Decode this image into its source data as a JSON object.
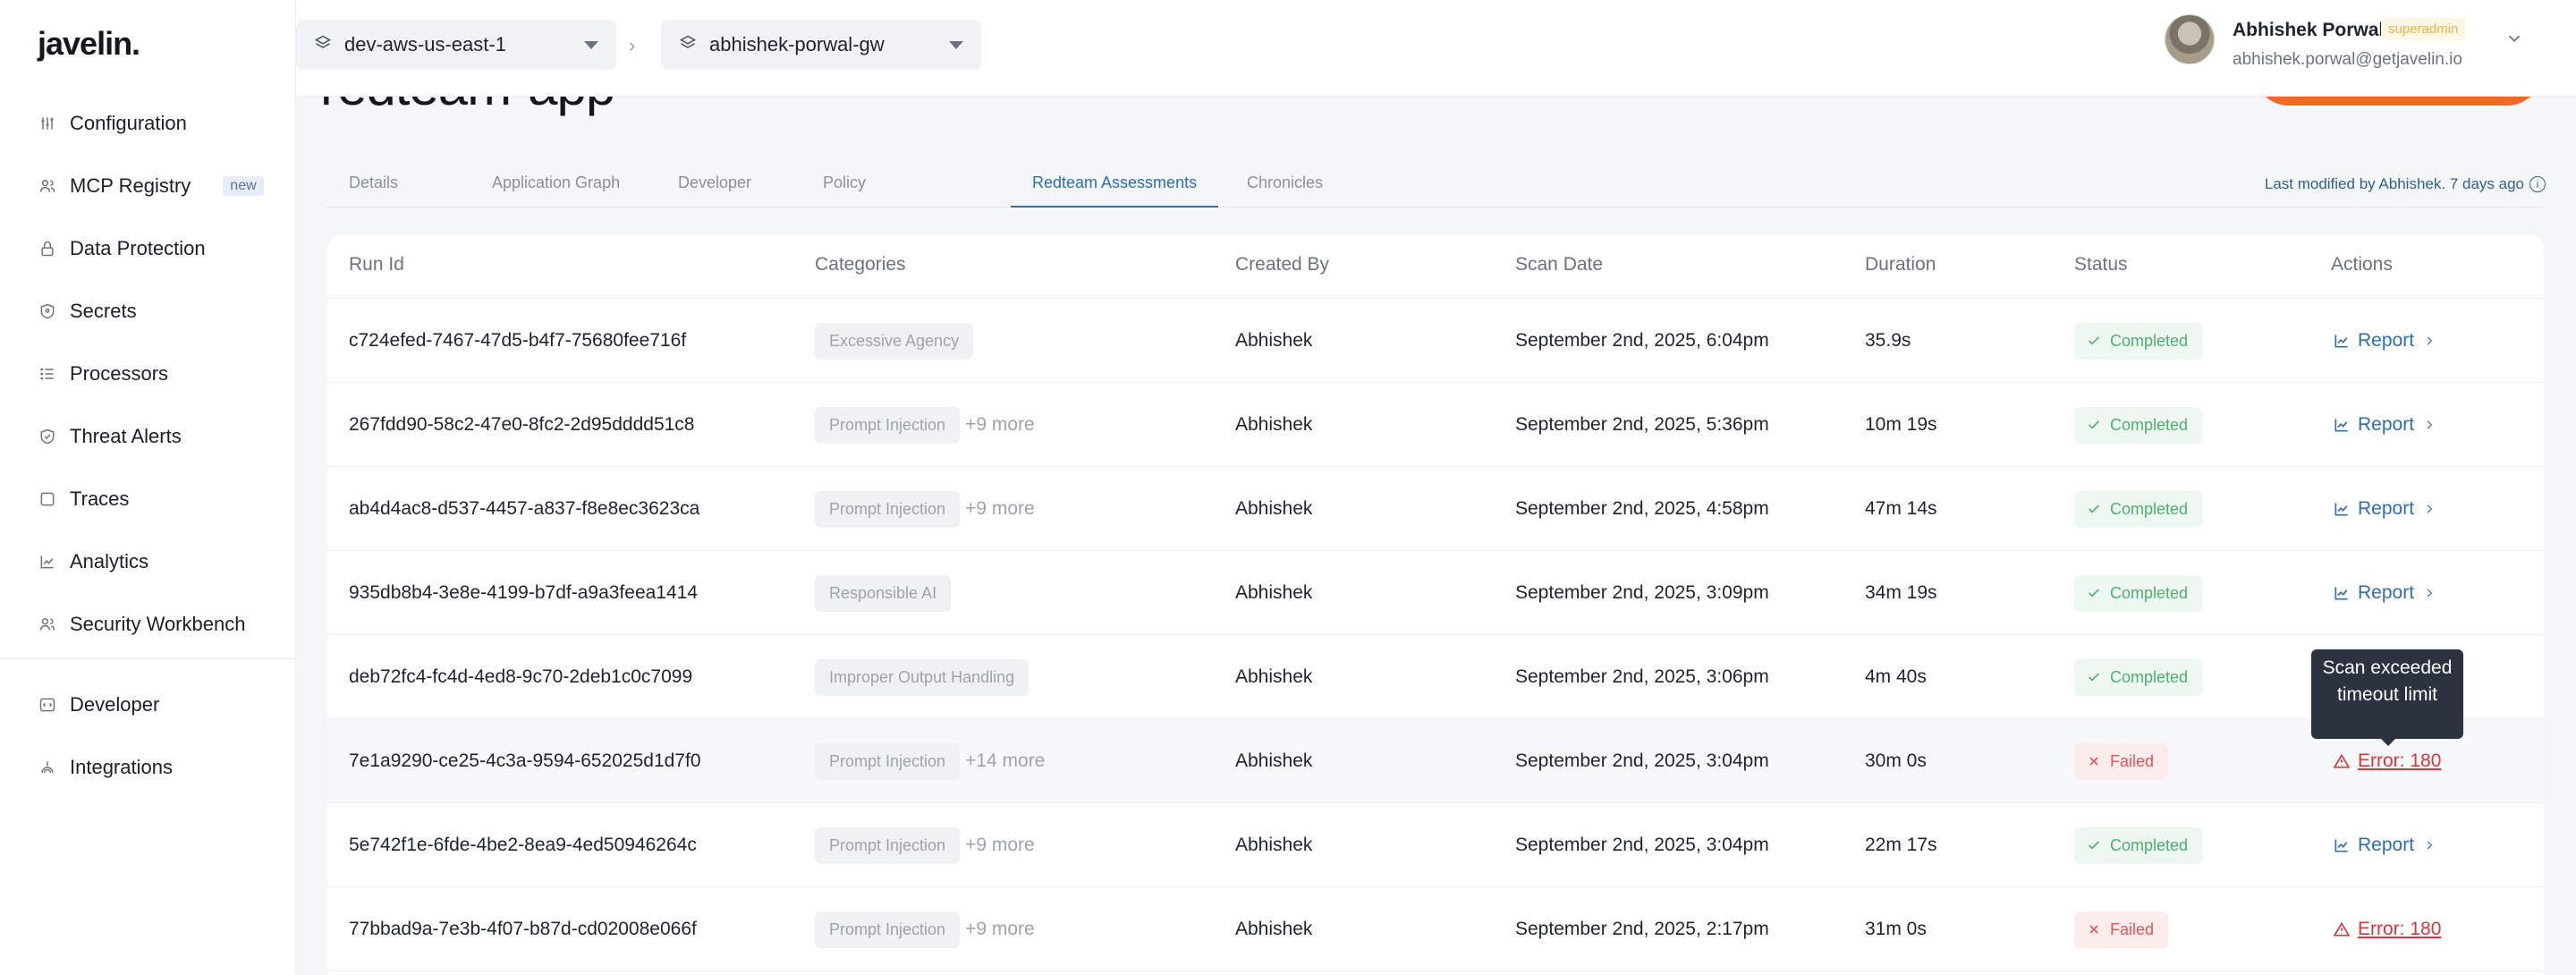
{
  "brand": {
    "logo": "javelin."
  },
  "sidebar": {
    "items": [
      {
        "label": "Configuration",
        "icon": "sliders-icon"
      },
      {
        "label": "MCP Registry",
        "icon": "users-icon",
        "badge": "new"
      },
      {
        "label": "Data Protection",
        "icon": "lock-icon"
      },
      {
        "label": "Secrets",
        "icon": "shield-icon"
      },
      {
        "label": "Processors",
        "icon": "list-icon"
      },
      {
        "label": "Threat Alerts",
        "icon": "shield-check-icon"
      },
      {
        "label": "Traces",
        "icon": "square-icon"
      },
      {
        "label": "Analytics",
        "icon": "chart-icon"
      },
      {
        "label": "Security Workbench",
        "icon": "users-icon"
      },
      {
        "label": "Developer",
        "icon": "code-icon"
      },
      {
        "label": "Integrations",
        "icon": "plug-icon"
      }
    ]
  },
  "topbar": {
    "env_selector": "dev-aws-us-east-1",
    "breadcrumb_sep": "›",
    "gateway_selector": "abhishek-porwal-gw"
  },
  "user": {
    "name": "Abhishek Porwal",
    "role": "superadmin",
    "email": "abhishek.porwal@getjavelin.io"
  },
  "page": {
    "title": "redteam-app",
    "last_modified": "Last modified by Abhishek. 7 days ago",
    "tabs": [
      {
        "label": "Details",
        "active": false
      },
      {
        "label": "Application Graph",
        "active": false
      },
      {
        "label": "Developer",
        "active": false
      },
      {
        "label": "Policy",
        "active": false
      },
      {
        "label": "Redteam Assessments",
        "active": true
      },
      {
        "label": "Chronicles",
        "active": false
      }
    ]
  },
  "table": {
    "columns": [
      "Run Id",
      "Categories",
      "Created By",
      "Scan Date",
      "Duration",
      "Status",
      "Actions"
    ],
    "rows": [
      {
        "run_id": "c724efed-7467-47d5-b4f7-75680fee716f",
        "category": "Excessive Agency",
        "more": "",
        "created_by": "Abhishek",
        "scan_date": "September 2nd, 2025, 6:04pm",
        "duration": "35.9s",
        "status": "Completed",
        "action": "Report"
      },
      {
        "run_id": "267fdd90-58c2-47e0-8fc2-2d95dddd51c8",
        "category": "Prompt Injection",
        "more": "+9 more",
        "created_by": "Abhishek",
        "scan_date": "September 2nd, 2025, 5:36pm",
        "duration": "10m 19s",
        "status": "Completed",
        "action": "Report"
      },
      {
        "run_id": "ab4d4ac8-d537-4457-a837-f8e8ec3623ca",
        "category": "Prompt Injection",
        "more": "+9 more",
        "created_by": "Abhishek",
        "scan_date": "September 2nd, 2025, 4:58pm",
        "duration": "47m 14s",
        "status": "Completed",
        "action": "Report"
      },
      {
        "run_id": "935db8b4-3e8e-4199-b7df-a9a3feea1414",
        "category": "Responsible AI",
        "more": "",
        "created_by": "Abhishek",
        "scan_date": "September 2nd, 2025, 3:09pm",
        "duration": "34m 19s",
        "status": "Completed",
        "action": "Report"
      },
      {
        "run_id": "deb72fc4-fc4d-4ed8-9c70-2deb1c0c7099",
        "category": "Improper Output Handling",
        "more": "",
        "created_by": "Abhishek",
        "scan_date": "September 2nd, 2025, 3:06pm",
        "duration": "4m 40s",
        "status": "Completed",
        "action": ""
      },
      {
        "run_id": "7e1a9290-ce25-4c3a-9594-652025d1d7f0",
        "category": "Prompt Injection",
        "more": "+14 more",
        "created_by": "Abhishek",
        "scan_date": "September 2nd, 2025, 3:04pm",
        "duration": "30m 0s",
        "status": "Failed",
        "action": "Error: 180"
      },
      {
        "run_id": "5e742f1e-6fde-4be2-8ea9-4ed50946264c",
        "category": "Prompt Injection",
        "more": "+9 more",
        "created_by": "Abhishek",
        "scan_date": "September 2nd, 2025, 3:04pm",
        "duration": "22m 17s",
        "status": "Completed",
        "action": "Report"
      },
      {
        "run_id": "77bbad9a-7e3b-4f07-b87d-cd02008e066f",
        "category": "Prompt Injection",
        "more": "+9 more",
        "created_by": "Abhishek",
        "scan_date": "September 2nd, 2025, 2:17pm",
        "duration": "31m 0s",
        "status": "Failed",
        "action": "Error: 180"
      }
    ]
  },
  "tooltip": {
    "text": "Scan exceeded timeout limit"
  },
  "colors": {
    "accent": "#2f6db3",
    "cta_orange": "#ef6a2a",
    "success": "#4caf74",
    "danger": "#d9363e"
  }
}
